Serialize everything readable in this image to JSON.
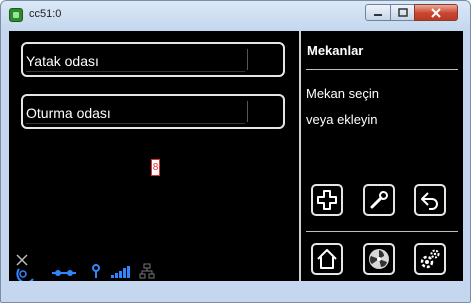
{
  "window": {
    "title": "cc51:0"
  },
  "rooms": [
    {
      "label": "Yatak odası"
    },
    {
      "label": "Oturma odası"
    }
  ],
  "marker": {
    "text": "8"
  },
  "panel": {
    "title": "Mekanlar",
    "hint_line1": "Mekan seçin",
    "hint_line2": "veya ekleyin"
  },
  "icons": {
    "add": "plus-icon",
    "edit": "wrench-icon",
    "back": "back-arrow-icon",
    "home": "home-icon",
    "system": "fan-icon",
    "settings": "gears-icon"
  },
  "colors": {
    "screen_bg": "#000000",
    "button_border": "#e6e6e6",
    "status_blue": "#2f86ff",
    "close_red": "#c9452e"
  }
}
